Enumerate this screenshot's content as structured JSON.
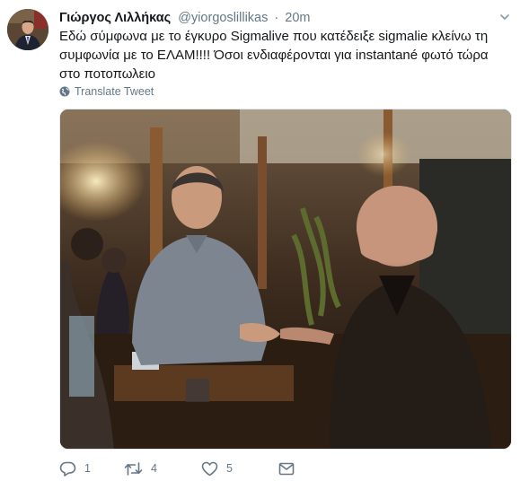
{
  "tweet": {
    "author_name": "Γιώργος Λιλλήκας",
    "author_handle": "@yiorgoslillikas",
    "separator": "·",
    "timestamp": "20m",
    "text": "Εδώ σύμφωνα με το έγκυρο Sigmalive που κατέδειξε sigmalie κλείνω τη συμφωνία με το ΕΛΑΜ!!!! Όσοι ενδιαφέρονται για instantané φωτό τώρα στο ποτοπωλειο",
    "translate_label": "Translate Tweet"
  },
  "actions": {
    "reply_count": "1",
    "retweet_count": "4",
    "like_count": "5"
  },
  "icons": {
    "caret": "chevron-down-icon",
    "translate": "globe-icon",
    "reply": "reply-icon",
    "retweet": "retweet-icon",
    "like": "heart-icon",
    "message": "envelope-icon"
  },
  "colors": {
    "text": "#14171a",
    "secondary": "#657786",
    "border": "#e1e8ed"
  }
}
